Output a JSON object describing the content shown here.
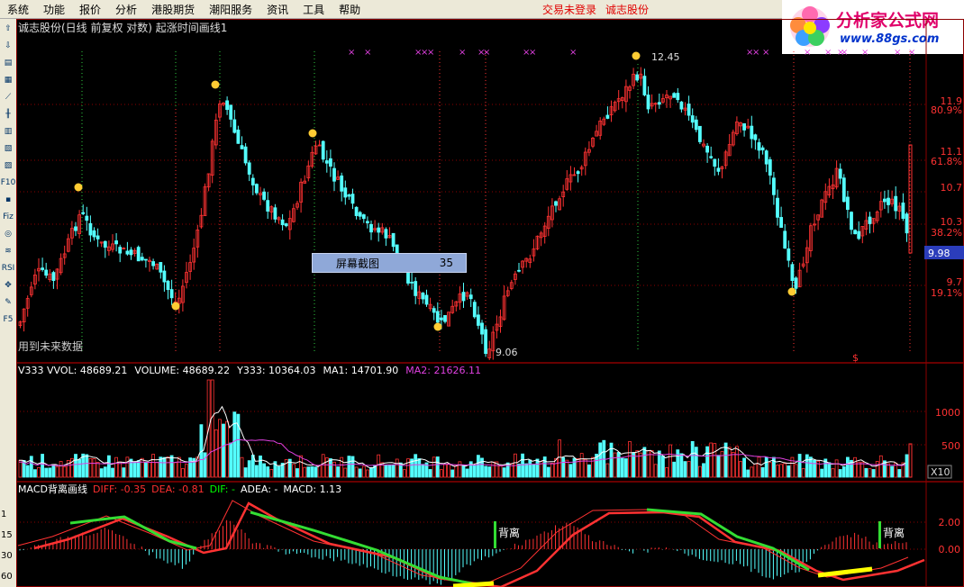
{
  "menu": {
    "items": [
      "系统",
      "功能",
      "报价",
      "分析",
      "港股期货",
      "潮阳服务",
      "资讯",
      "工具",
      "帮助"
    ],
    "status_text": "交易未登录",
    "stock_name": "诚志股份"
  },
  "logo": {
    "brand": "分析家公式网",
    "url": "www.88gs.com"
  },
  "toolbar": {
    "icons": [
      "arrow-up-icon",
      "arrow-down-icon",
      "page-icon",
      "grid-icon",
      "line-icon",
      "candle-icon",
      "bar-icon",
      "fin-icon",
      "chart-icon",
      "f10-icon",
      "fiz-icon",
      "target-icon",
      "wave-icon",
      "rsi-icon",
      "arrows-icon",
      "pen-icon",
      "f5-icon",
      "settings-icon"
    ],
    "labels": [
      "",
      "",
      "",
      "",
      "",
      "",
      "",
      "",
      "",
      "F10",
      "",
      "Fiz",
      "",
      "",
      "RSI",
      "",
      "",
      "F5",
      ""
    ]
  },
  "main_panel": {
    "title": "诚志股份(日线 前复权 对数) 起涨时间画线1",
    "bottom_note": "用到未来数据",
    "price_labels": [
      "11.9",
      "80.9%",
      "11.1",
      "61.8%",
      "10.7",
      "10.3",
      "38.2%",
      "9.7",
      "19.1%"
    ],
    "current_price": "9.98",
    "high_label": "12.45",
    "low_label": "9.06"
  },
  "volume_panel": {
    "header": [
      {
        "text": "V333 VVOL: 48689.21",
        "color": "#ffffff"
      },
      {
        "text": "VOLUME: 48689.22",
        "color": "#ffffff"
      },
      {
        "text": "Y333: 10364.03",
        "color": "#ffffff"
      },
      {
        "text": "MA1: 14701.90",
        "color": "#ffffff"
      },
      {
        "text": "MA2: 21626.11",
        "color": "#e040e0"
      }
    ],
    "axis_labels": [
      "1000",
      "500"
    ],
    "unit": "X10"
  },
  "macd_panel": {
    "header": [
      {
        "text": "MACD背离画线",
        "color": "#ffffff"
      },
      {
        "text": "DIFF: -0.35",
        "color": "#ff3030"
      },
      {
        "text": "DEA: -0.81",
        "color": "#ff3030"
      },
      {
        "text": "DIF: -",
        "color": "#00ff00"
      },
      {
        "text": "ADEA: -",
        "color": "#ffffff"
      },
      {
        "text": "MACD: 1.13",
        "color": "#ffffff"
      }
    ],
    "axis_labels": [
      "2.00",
      "0.00"
    ],
    "divergence_label": "背离",
    "left_numbers": [
      "1",
      "15",
      "30",
      "60"
    ]
  },
  "screenshot_popup": {
    "label": "屏幕截图",
    "value": "35"
  },
  "colors": {
    "up": "#ff3232",
    "down": "#54ffff",
    "grid": "#8b0000",
    "highlight": "#e040e0"
  }
}
